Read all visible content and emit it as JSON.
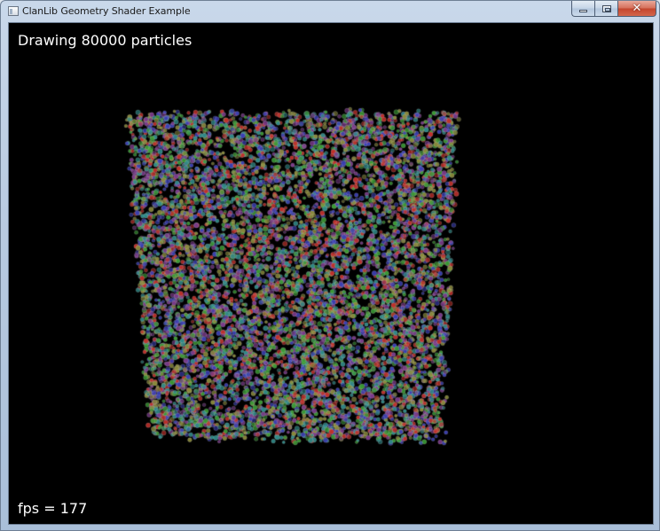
{
  "window": {
    "title": "ClanLib Geometry Shader Example",
    "close_glyph": "✕"
  },
  "scene": {
    "status_label": "Drawing 80000 particles",
    "fps_label": "fps = 177",
    "particle_count": 80000,
    "background_color": "#000000",
    "particle_colors": [
      "#c0302a",
      "#3a9a34",
      "#3b3fb4",
      "#8a8a3a",
      "#7a3a8a",
      "#2f8a88"
    ]
  }
}
